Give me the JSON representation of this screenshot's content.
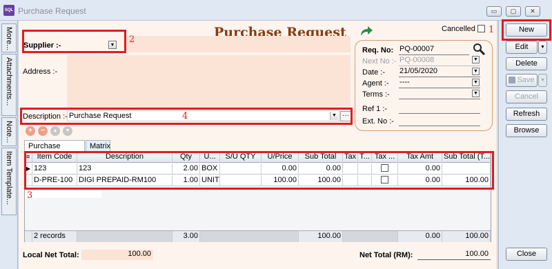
{
  "window": {
    "title": "Purchase Request",
    "app_icon_text": "SQL",
    "minimize_glyph": "▭",
    "maximize_glyph": "▢",
    "close_glyph": "✕"
  },
  "sidebar": {
    "tabs": [
      "More...",
      "Attachments...",
      "Note...",
      "Item Template..."
    ]
  },
  "form": {
    "heading": "Purchase Request",
    "cancelled_label": "Cancelled",
    "supplier_label": "Supplier :-",
    "address_label": "Address :-",
    "description_label": "Description :-",
    "description_value": "Purchase Request",
    "annotations": [
      "1",
      "2",
      "3",
      "4"
    ],
    "arrow_icon": "forward-arrow-icon"
  },
  "info": {
    "req_no_label": "Req. No:",
    "req_no_value": "PQ-00007",
    "next_no_label": "Next No :-",
    "next_no_value": "PQ-00008",
    "date_label": "Date :-",
    "date_value": "21/05/2020",
    "agent_label": "Agent :-",
    "agent_value": "----",
    "terms_label": "Terms :-",
    "terms_value": "",
    "ref_label": "Ref 1 :-",
    "ref_value": "",
    "ext_label": "Ext. No :-",
    "ext_value": ""
  },
  "toolbar": {
    "add_glyph": "+",
    "remove_glyph": "−",
    "up_glyph": "▲",
    "down_glyph": "▼"
  },
  "tabs": [
    "Purchase Request",
    "Matrix"
  ],
  "grid": {
    "columns": [
      "Item Code",
      "Description",
      "Qty",
      "U...",
      "S/U QTY",
      "U/Price",
      "Sub Total",
      "Tax",
      "T...",
      "Tax ...",
      "Tax Amt",
      "Sub Total (T..."
    ],
    "rows": [
      {
        "item_code": "123",
        "description": "123",
        "qty": "2.00",
        "uom": "BOX",
        "su_qty": "",
        "u_price": "0.00",
        "sub_total": "0.00",
        "tax": "",
        "t": "",
        "tax_amt": "0.00",
        "sub_total_t": ""
      },
      {
        "item_code": "D-PRE-100",
        "description": "DIGI PREPAID-RM100",
        "qty": "1.00",
        "uom": "UNIT",
        "su_qty": "",
        "u_price": "100.00",
        "sub_total": "100.00",
        "tax": "",
        "t": "",
        "tax_amt": "0.00",
        "sub_total_t": "100.00"
      }
    ],
    "footer": {
      "records": "2 records",
      "qty": "3.00",
      "sub_total": "100.00",
      "tax_amt": "0.00",
      "sub_total_t": "100.00"
    }
  },
  "totals": {
    "local_net_label": "Local Net Total:",
    "local_net_value": "100.00",
    "net_total_label": "Net Total (RM):",
    "net_total_value": "100.00"
  },
  "buttons": {
    "new": "New",
    "edit": "Edit",
    "delete": "Delete",
    "save": "Save",
    "cancel": "Cancel",
    "refresh": "Refresh",
    "browse": "Browse",
    "close": "Close"
  },
  "colors": {
    "annotation_red": "#e11b22",
    "heading_brown": "#8b3a0e",
    "form_background": "#fdf4ee"
  }
}
